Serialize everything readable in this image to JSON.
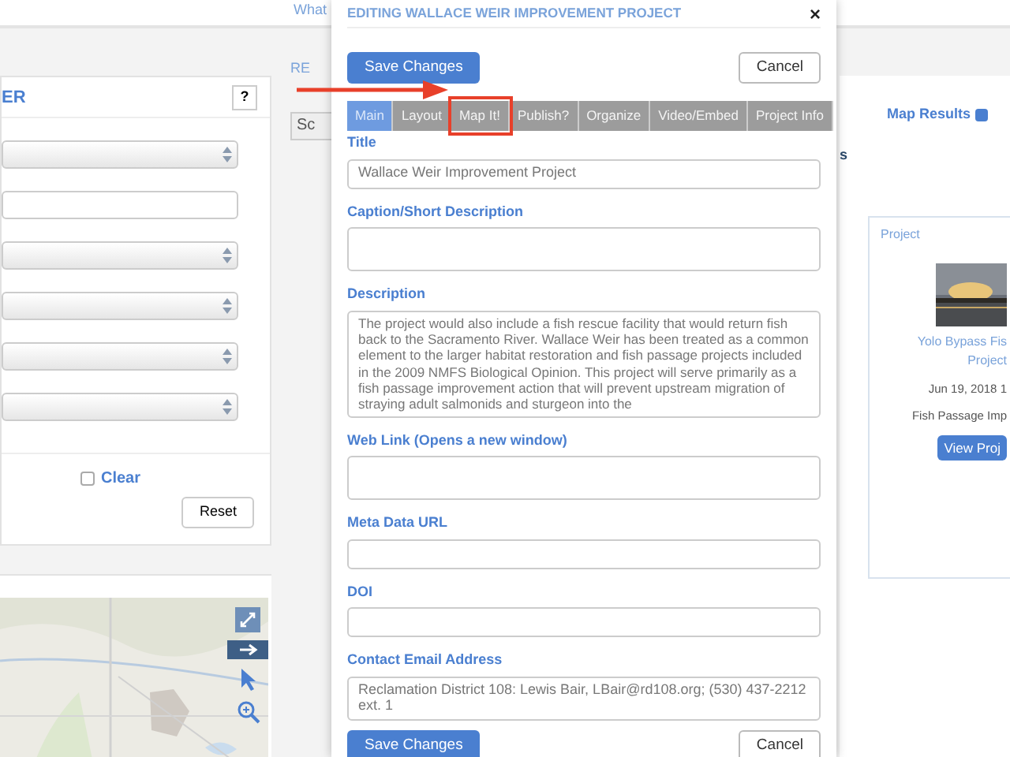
{
  "top_nav": {
    "link": "What"
  },
  "filter_panel": {
    "title": "ER",
    "help": "?",
    "fields": [
      {
        "kind": "select"
      },
      {
        "kind": "input"
      },
      {
        "kind": "select"
      },
      {
        "kind": "select"
      },
      {
        "kind": "select"
      },
      {
        "kind": "select"
      }
    ],
    "clear": {
      "label": "Clear",
      "checked": false
    },
    "reset": "Reset"
  },
  "results": {
    "heading": "RE",
    "sort": "Sc",
    "map_results": {
      "label": "Map Results",
      "checked": true
    },
    "tab_fragment": "s",
    "card": {
      "label": "Project",
      "title_lines": [
        "Yolo Bypass Fis",
        "Project"
      ],
      "date": "Jun 19, 2018 1",
      "category": "Fish Passage Imp",
      "button": "View Proj"
    }
  },
  "modal": {
    "title": "EDITING WALLACE WEIR IMPROVEMENT PROJECT",
    "close": "×",
    "save": "Save Changes",
    "cancel": "Cancel",
    "tabs": [
      {
        "label": "Main",
        "selected": true,
        "highlighted": false
      },
      {
        "label": "Layout",
        "selected": false,
        "highlighted": false
      },
      {
        "label": "Map It!",
        "selected": false,
        "highlighted": true
      },
      {
        "label": "Publish?",
        "selected": false,
        "highlighted": false
      },
      {
        "label": "Organize",
        "selected": false,
        "highlighted": false
      },
      {
        "label": "Video/Embed",
        "selected": false,
        "highlighted": false
      },
      {
        "label": "Project Info",
        "selected": false,
        "highlighted": false
      }
    ],
    "fields": [
      {
        "label": "Title",
        "kind": "input",
        "value": "Wallace Weir Improvement Project"
      },
      {
        "label": "Caption/Short Description",
        "kind": "textarea"
      },
      {
        "label": "Description",
        "kind": "textarea_tall",
        "value": "The project would also include a fish rescue facility that would return fish back to the Sacramento River. Wallace Weir has been treated as a common element to the larger habitat restoration and fish passage projects included in the 2009 NMFS Biological Opinion. This project will serve primarily as a fish passage improvement action that will prevent upstream migration of straying adult salmonids and sturgeon into the"
      },
      {
        "label": "Web Link (Opens a new window)",
        "kind": "textarea"
      },
      {
        "label": "Meta Data URL",
        "kind": "input"
      },
      {
        "label": "DOI",
        "kind": "input"
      },
      {
        "label": "Contact Email Address",
        "kind": "textarea",
        "value": "Reclamation District 108: Lewis Bair, LBair@rd108.org; (530) 437-2212 ext. 1"
      }
    ],
    "footer_save": "Save Changes",
    "footer_cancel": "Cancel"
  }
}
